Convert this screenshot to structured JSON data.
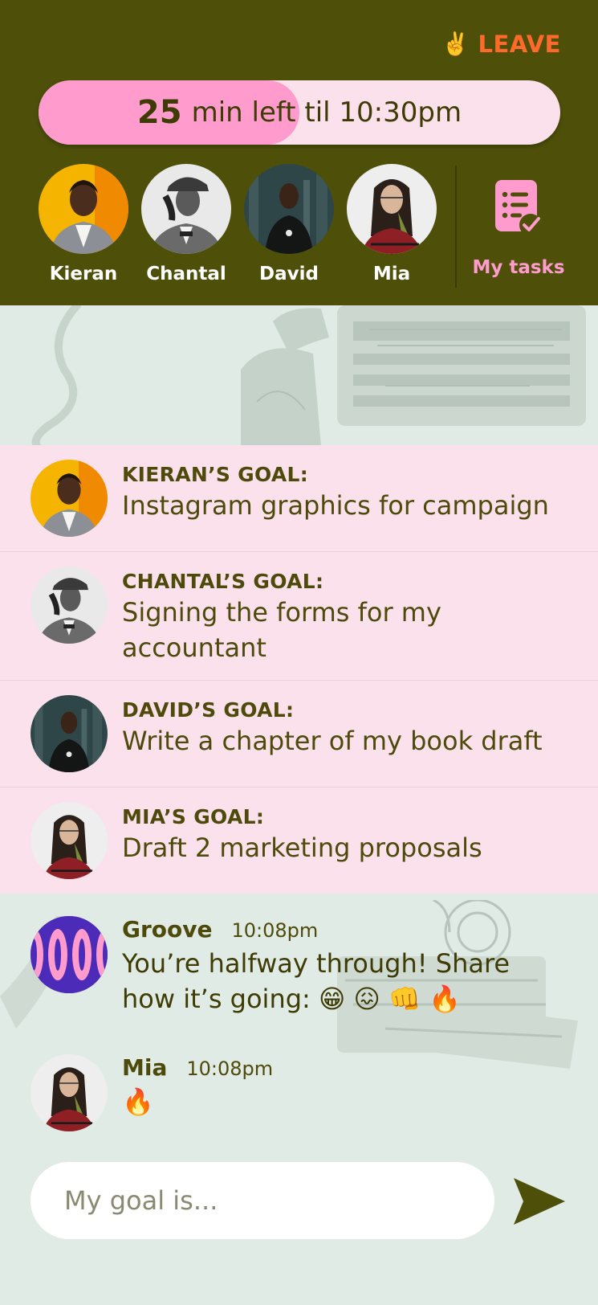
{
  "header": {
    "leave": {
      "icon": "victory-hand-icon",
      "glyph": "✌️",
      "label": "LEAVE"
    },
    "timer": {
      "minutes": "25",
      "rest": "min left til 10:30pm",
      "progress": 0.5
    },
    "members": [
      {
        "name": "Kieran"
      },
      {
        "name": "Chantal"
      },
      {
        "name": "David"
      },
      {
        "name": "Mia"
      }
    ],
    "my_tasks": {
      "label": "My tasks",
      "icon": "task-list-icon"
    }
  },
  "goals": [
    {
      "label": "KIERAN’S GOAL:",
      "desc": "Instagram graphics for campaign"
    },
    {
      "label": "CHANTAL’S GOAL:",
      "desc": "Signing the forms for my accountant"
    },
    {
      "label": "DAVID’S GOAL:",
      "desc": "Write a chapter of my book draft"
    },
    {
      "label": "MIA’S GOAL:",
      "desc": "Draft 2 marketing proposals"
    }
  ],
  "messages": [
    {
      "author": "Groove",
      "time": "10:08pm",
      "body": "You’re halfway through! Share how it’s going: 😁 😖 👊 🔥"
    },
    {
      "author": "Mia",
      "time": "10:08pm",
      "body": "🔥"
    }
  ],
  "composer": {
    "placeholder": "My goal is...",
    "send_icon": "send-icon"
  },
  "colors": {
    "header_bg": "#4e500a",
    "accent_pink": "#ff9ccd",
    "pink_bg": "#fbe1ec",
    "leave_orange": "#ff6a2a",
    "app_bg": "#e1ebe5"
  }
}
